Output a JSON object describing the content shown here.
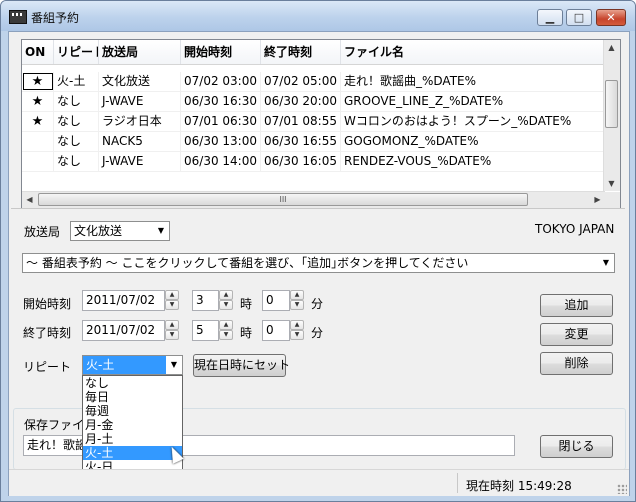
{
  "window": {
    "title": "番組予約",
    "minimize_glyph": "▁",
    "maximize_glyph": "□",
    "close_glyph": "✕"
  },
  "table": {
    "columns": [
      "ON",
      "リピート",
      "放送局",
      "開始時刻",
      "終了時刻",
      "ファイル名"
    ],
    "rows": [
      {
        "on": "★",
        "repeat": "火-土",
        "station": "文化放送",
        "start": "07/02 03:00",
        "end": "07/02 05:00",
        "file": "走れ！歌謡曲_%DATE%"
      },
      {
        "on": "★",
        "repeat": "なし",
        "station": "J-WAVE",
        "start": "06/30 16:30",
        "end": "06/30 20:00",
        "file": "GROOVE_LINE_Z_%DATE%"
      },
      {
        "on": "★",
        "repeat": "なし",
        "station": "ラジオ日本",
        "start": "07/01 06:30",
        "end": "07/01 08:55",
        "file": "Wコロンのおはよう！スプーン_%DATE%"
      },
      {
        "on": "",
        "repeat": "なし",
        "station": "NACK5",
        "start": "06/30 13:00",
        "end": "06/30 16:55",
        "file": "GOGOMONZ_%DATE%"
      },
      {
        "on": "",
        "repeat": "なし",
        "station": "J-WAVE",
        "start": "06/30 14:00",
        "end": "06/30 16:05",
        "file": "RENDEZ-VOUS_%DATE%"
      }
    ],
    "hscroll_grip": "III"
  },
  "station": {
    "label": "放送局",
    "value": "文化放送",
    "region": "TOKYO JAPAN"
  },
  "program_guide": {
    "text": "～ 番組表予約 ～ ここをクリックして番組を選び、｢追加｣ボタンを押してください"
  },
  "start": {
    "label": "開始時刻",
    "date": "2011/07/02",
    "hour": "3",
    "hour_unit": "時",
    "minute": "0",
    "minute_unit": "分"
  },
  "end": {
    "label": "終了時刻",
    "date": "2011/07/02",
    "hour": "5",
    "hour_unit": "時",
    "minute": "0",
    "minute_unit": "分"
  },
  "repeat": {
    "label": "リピート",
    "value": "火-土",
    "set_now_button": "現在日時にセット",
    "options": [
      "なし",
      "毎日",
      "毎週",
      "月-金",
      "月-土",
      "火-土",
      "火-日"
    ],
    "selected_index": 5
  },
  "buttons": {
    "add": "追加",
    "change": "変更",
    "delete": "削除",
    "close": "閉じる"
  },
  "save": {
    "label": "保存ファイル名",
    "value": "走れ！歌謡曲_%DATE%"
  },
  "status": {
    "current_time": "現在時刻 15:49:28"
  }
}
